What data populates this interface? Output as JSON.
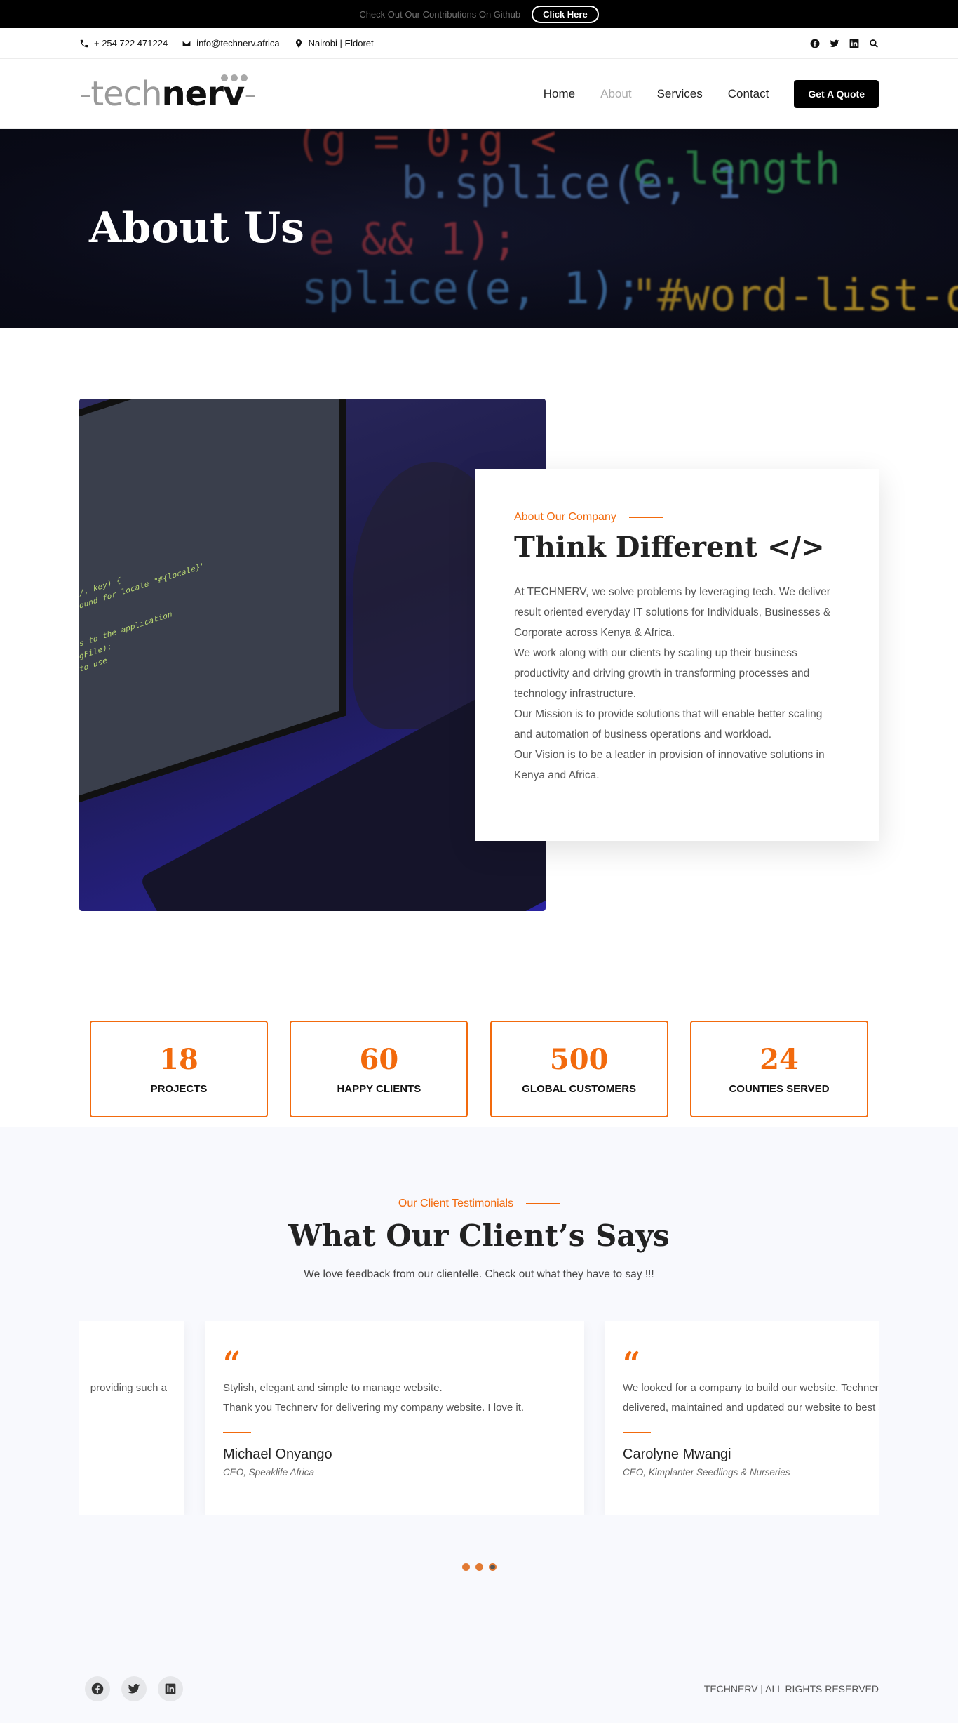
{
  "announce": {
    "text": "Check Out Our Contributions On Github",
    "button": "Click Here"
  },
  "contact": {
    "phone": "+ 254 722 471224",
    "email": "info@technerv.africa",
    "location": "Nairobi | Eldoret"
  },
  "logo": {
    "dash_left": "-",
    "tech": "tech",
    "nerv": "nerv",
    "dash_right": "-"
  },
  "nav": {
    "items": [
      "Home",
      "About",
      "Services",
      "Contact"
    ],
    "active": "About",
    "quote_button": "Get A Quote"
  },
  "hero": {
    "title": "About Us"
  },
  "about": {
    "kicker": "About Our Company",
    "title": "Think Different </>",
    "paragraphs": [
      "At TECHNERV, we solve problems by leveraging tech. We deliver result oriented everyday IT solutions for Individuals, Businesses & Corporate across Kenya & Africa.",
      "We work along with our clients by scaling up their business productivity and driving growth in transforming processes and technology infrastructure.",
      "Our Mission is to provide solutions that will enable better scaling and automation of business operations and workload.",
      "Our Vision is to be a leader in provision of innovative solutions in Kenya and Africa."
    ]
  },
  "stats": [
    {
      "num": "18",
      "label": "PROJECTS"
    },
    {
      "num": "60",
      "label": "HAPPY CLIENTS"
    },
    {
      "num": "500",
      "label": "GLOBAL CUSTOMERS"
    },
    {
      "num": "24",
      "label": "COUNTIES SERVED"
    }
  ],
  "testimonials": {
    "kicker": "Our Client Testimonials",
    "title": "What Our Client’s Says",
    "subtitle": "We love feedback from our clientelle. Check out what they have to say !!!",
    "cards": [
      {
        "quote_mark": "“",
        "lines": [
          "providing such a",
          ""
        ],
        "name": "",
        "role": ""
      },
      {
        "quote_mark": "“",
        "lines": [
          "Stylish, elegant and simple to manage website.",
          "Thank you Technerv for delivering my company website. I love it."
        ],
        "name": "Michael Onyango",
        "role": "CEO, Speaklife Africa"
      },
      {
        "quote_mark": "“",
        "lines": [
          "We looked for a company to build our website. Technerv",
          "delivered, maintained and updated our website to best s"
        ],
        "name": "Carolyne Mwangi",
        "role": "CEO, Kimplanter Seedlings & Nurseries"
      }
    ]
  },
  "footer": {
    "copyright": "TECHNERV | ALL RIGHTS RESERVED"
  },
  "colors": {
    "accent": "#f26a0d",
    "dark": "#000000",
    "section_bg": "#f8f9fd"
  },
  "icons": [
    "phone-icon",
    "email-icon",
    "location-icon",
    "facebook-icon",
    "twitter-icon",
    "linkedin-icon",
    "search-icon"
  ]
}
